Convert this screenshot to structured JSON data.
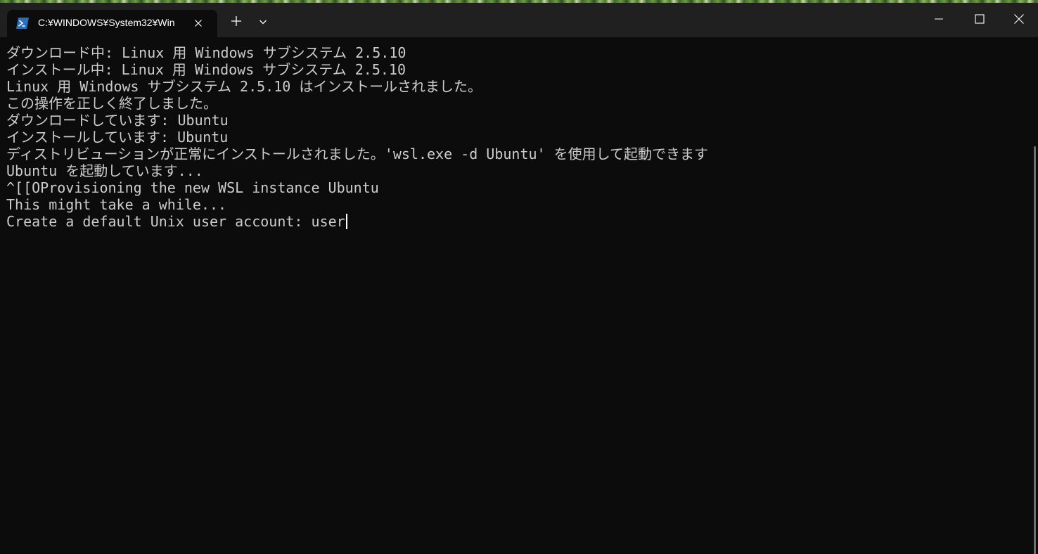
{
  "window": {
    "tab_title": "C:¥WINDOWS¥System32¥Win",
    "tab_icon": "powershell-icon",
    "new_tab_icon": "plus-icon",
    "dropdown_icon": "chevron-down-icon",
    "minimize_icon": "minimize-icon",
    "maximize_icon": "maximize-icon",
    "close_icon": "close-icon"
  },
  "terminal": {
    "lines": [
      "ダウンロード中: Linux 用 Windows サブシステム 2.5.10",
      "インストール中: Linux 用 Windows サブシステム 2.5.10",
      "Linux 用 Windows サブシステム 2.5.10 はインストールされました。",
      "この操作を正しく終了しました。",
      "ダウンロードしています: Ubuntu",
      "インストールしています: Ubuntu",
      "ディストリビューションが正常にインストールされました。'wsl.exe -d Ubuntu' を使用して起動できます",
      "Ubuntu を起動しています...",
      "^[[OProvisioning the new WSL instance Ubuntu",
      "This might take a while...",
      "Create a default Unix user account: "
    ],
    "input_value": "user"
  },
  "colors": {
    "terminal_background": "#0c0c0c",
    "titlebar_background": "#202020",
    "terminal_text": "#cccccc",
    "powershell_blue": "#2671be"
  }
}
